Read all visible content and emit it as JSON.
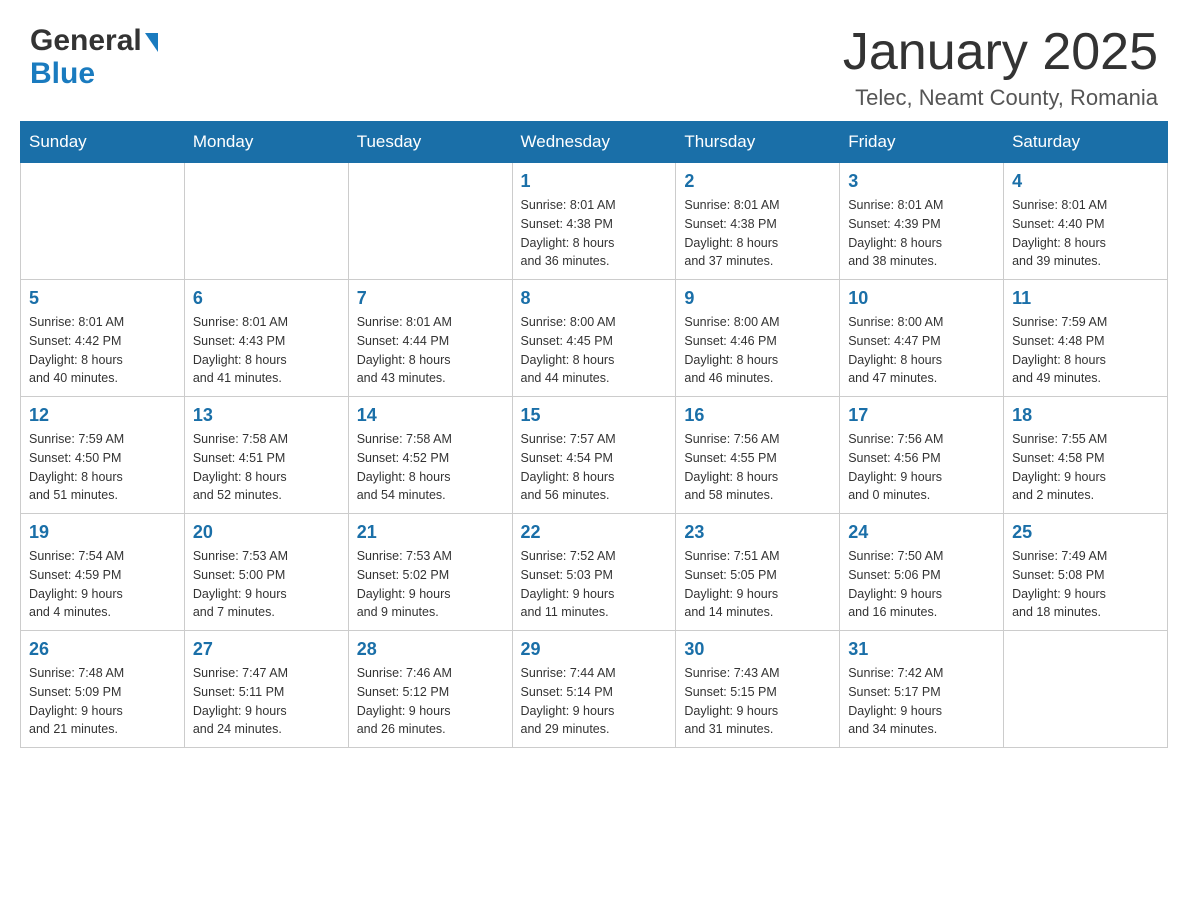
{
  "header": {
    "logo_general": "General",
    "logo_blue": "Blue",
    "main_title": "January 2025",
    "subtitle": "Telec, Neamt County, Romania"
  },
  "calendar": {
    "days_of_week": [
      "Sunday",
      "Monday",
      "Tuesday",
      "Wednesday",
      "Thursday",
      "Friday",
      "Saturday"
    ],
    "weeks": [
      [
        {
          "day": "",
          "info": ""
        },
        {
          "day": "",
          "info": ""
        },
        {
          "day": "",
          "info": ""
        },
        {
          "day": "1",
          "info": "Sunrise: 8:01 AM\nSunset: 4:38 PM\nDaylight: 8 hours\nand 36 minutes."
        },
        {
          "day": "2",
          "info": "Sunrise: 8:01 AM\nSunset: 4:38 PM\nDaylight: 8 hours\nand 37 minutes."
        },
        {
          "day": "3",
          "info": "Sunrise: 8:01 AM\nSunset: 4:39 PM\nDaylight: 8 hours\nand 38 minutes."
        },
        {
          "day": "4",
          "info": "Sunrise: 8:01 AM\nSunset: 4:40 PM\nDaylight: 8 hours\nand 39 minutes."
        }
      ],
      [
        {
          "day": "5",
          "info": "Sunrise: 8:01 AM\nSunset: 4:42 PM\nDaylight: 8 hours\nand 40 minutes."
        },
        {
          "day": "6",
          "info": "Sunrise: 8:01 AM\nSunset: 4:43 PM\nDaylight: 8 hours\nand 41 minutes."
        },
        {
          "day": "7",
          "info": "Sunrise: 8:01 AM\nSunset: 4:44 PM\nDaylight: 8 hours\nand 43 minutes."
        },
        {
          "day": "8",
          "info": "Sunrise: 8:00 AM\nSunset: 4:45 PM\nDaylight: 8 hours\nand 44 minutes."
        },
        {
          "day": "9",
          "info": "Sunrise: 8:00 AM\nSunset: 4:46 PM\nDaylight: 8 hours\nand 46 minutes."
        },
        {
          "day": "10",
          "info": "Sunrise: 8:00 AM\nSunset: 4:47 PM\nDaylight: 8 hours\nand 47 minutes."
        },
        {
          "day": "11",
          "info": "Sunrise: 7:59 AM\nSunset: 4:48 PM\nDaylight: 8 hours\nand 49 minutes."
        }
      ],
      [
        {
          "day": "12",
          "info": "Sunrise: 7:59 AM\nSunset: 4:50 PM\nDaylight: 8 hours\nand 51 minutes."
        },
        {
          "day": "13",
          "info": "Sunrise: 7:58 AM\nSunset: 4:51 PM\nDaylight: 8 hours\nand 52 minutes."
        },
        {
          "day": "14",
          "info": "Sunrise: 7:58 AM\nSunset: 4:52 PM\nDaylight: 8 hours\nand 54 minutes."
        },
        {
          "day": "15",
          "info": "Sunrise: 7:57 AM\nSunset: 4:54 PM\nDaylight: 8 hours\nand 56 minutes."
        },
        {
          "day": "16",
          "info": "Sunrise: 7:56 AM\nSunset: 4:55 PM\nDaylight: 8 hours\nand 58 minutes."
        },
        {
          "day": "17",
          "info": "Sunrise: 7:56 AM\nSunset: 4:56 PM\nDaylight: 9 hours\nand 0 minutes."
        },
        {
          "day": "18",
          "info": "Sunrise: 7:55 AM\nSunset: 4:58 PM\nDaylight: 9 hours\nand 2 minutes."
        }
      ],
      [
        {
          "day": "19",
          "info": "Sunrise: 7:54 AM\nSunset: 4:59 PM\nDaylight: 9 hours\nand 4 minutes."
        },
        {
          "day": "20",
          "info": "Sunrise: 7:53 AM\nSunset: 5:00 PM\nDaylight: 9 hours\nand 7 minutes."
        },
        {
          "day": "21",
          "info": "Sunrise: 7:53 AM\nSunset: 5:02 PM\nDaylight: 9 hours\nand 9 minutes."
        },
        {
          "day": "22",
          "info": "Sunrise: 7:52 AM\nSunset: 5:03 PM\nDaylight: 9 hours\nand 11 minutes."
        },
        {
          "day": "23",
          "info": "Sunrise: 7:51 AM\nSunset: 5:05 PM\nDaylight: 9 hours\nand 14 minutes."
        },
        {
          "day": "24",
          "info": "Sunrise: 7:50 AM\nSunset: 5:06 PM\nDaylight: 9 hours\nand 16 minutes."
        },
        {
          "day": "25",
          "info": "Sunrise: 7:49 AM\nSunset: 5:08 PM\nDaylight: 9 hours\nand 18 minutes."
        }
      ],
      [
        {
          "day": "26",
          "info": "Sunrise: 7:48 AM\nSunset: 5:09 PM\nDaylight: 9 hours\nand 21 minutes."
        },
        {
          "day": "27",
          "info": "Sunrise: 7:47 AM\nSunset: 5:11 PM\nDaylight: 9 hours\nand 24 minutes."
        },
        {
          "day": "28",
          "info": "Sunrise: 7:46 AM\nSunset: 5:12 PM\nDaylight: 9 hours\nand 26 minutes."
        },
        {
          "day": "29",
          "info": "Sunrise: 7:44 AM\nSunset: 5:14 PM\nDaylight: 9 hours\nand 29 minutes."
        },
        {
          "day": "30",
          "info": "Sunrise: 7:43 AM\nSunset: 5:15 PM\nDaylight: 9 hours\nand 31 minutes."
        },
        {
          "day": "31",
          "info": "Sunrise: 7:42 AM\nSunset: 5:17 PM\nDaylight: 9 hours\nand 34 minutes."
        },
        {
          "day": "",
          "info": ""
        }
      ]
    ]
  }
}
